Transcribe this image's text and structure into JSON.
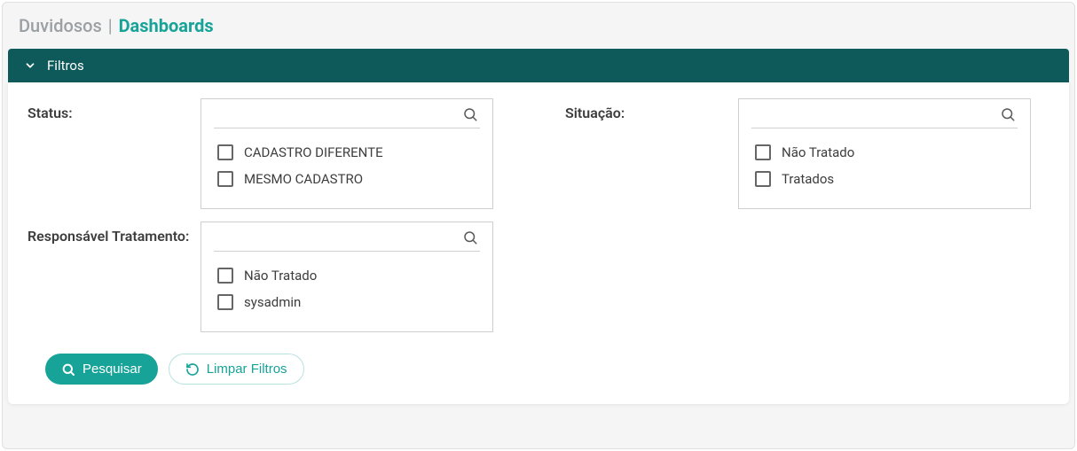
{
  "header": {
    "crumb1": "Duvidosos",
    "crumb2": "Dashboards"
  },
  "filtersBar": {
    "label": "Filtros"
  },
  "fields": {
    "status": {
      "label": "Status:",
      "options": [
        "CADASTRO DIFERENTE",
        "MESMO CADASTRO"
      ]
    },
    "situacao": {
      "label": "Situação:",
      "options": [
        "Não Tratado",
        "Tratados"
      ]
    },
    "responsavel": {
      "label": "Responsável Tratamento:",
      "options": [
        "Não Tratado",
        "sysadmin"
      ]
    }
  },
  "buttons": {
    "search": "Pesquisar",
    "clear": "Limpar Filtros"
  }
}
